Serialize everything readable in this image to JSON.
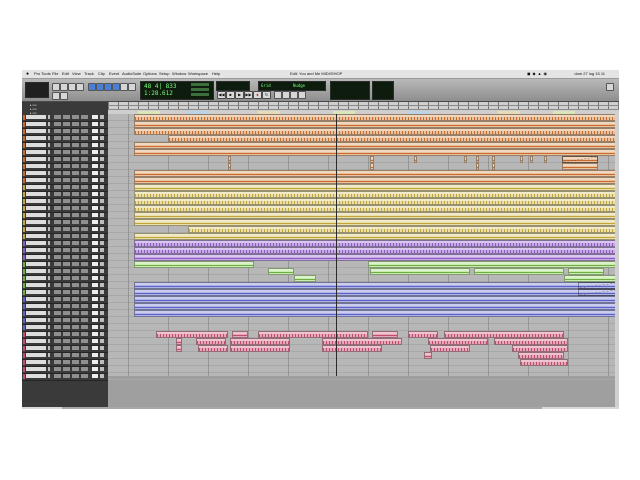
{
  "app": {
    "menu": [
      "Pro Tools",
      "File",
      "Edit",
      "View",
      "Track",
      "Clip",
      "Event",
      "AudioSuite",
      "Options",
      "Setup",
      "Window",
      "Workspace",
      "Help"
    ],
    "window_title": "Edit: You and Me MIDI/SHOP",
    "clock": "dom 27 lug 15 11"
  },
  "transport": {
    "main_counter": "48 4| 833",
    "sub_counter": "1:28.612",
    "grid_label": "Grid",
    "nudge_label": "Nudge"
  },
  "colors": {
    "orange": "#e9c39f",
    "yellow": "#e9dfab",
    "purple": "#c7a9e6",
    "green": "#c9ecb0",
    "blue": "#b0b2e6",
    "pink": "#e3a7b7"
  }
}
